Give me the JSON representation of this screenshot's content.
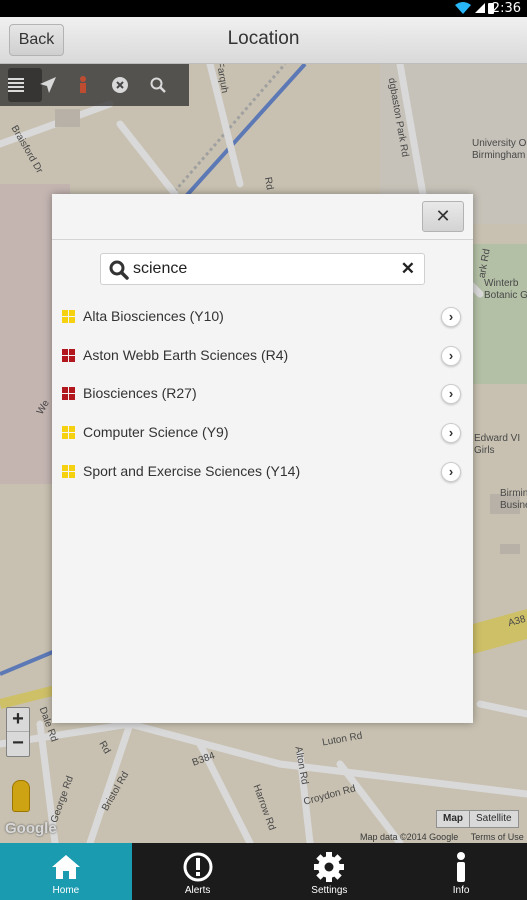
{
  "status_bar": {
    "time": "2:36"
  },
  "header": {
    "back_label": "Back",
    "title": "Location"
  },
  "map": {
    "street_labels": [
      "Farquh",
      "dgbaston Park Rd",
      "University O",
      "Birmingham",
      "Bristol Rd",
      "B384",
      "Luton Rd",
      "Croydon Rd",
      "Harrow Rd",
      "Alton Rd",
      "George Rd",
      "Dale Rd",
      "Edward VI",
      "Girls",
      "Winterb",
      "Botanic G",
      "Birmin",
      "Busine",
      "A38",
      "Braisford Dr",
      "Rd",
      "Rd",
      "ark Rd",
      "We"
    ],
    "zoom_in": "+",
    "zoom_out": "−",
    "logo_text": "Google",
    "map_types": [
      "Map",
      "Satellite"
    ],
    "attribution": "Map data ©2014 Google",
    "terms": "Terms of Use"
  },
  "dialog": {
    "close_symbol": "✕",
    "search": {
      "value": "science",
      "clear_symbol": "✕"
    },
    "results": [
      {
        "label": "Alta Biosciences (Y10)",
        "color": "#f5d10f"
      },
      {
        "label": "Aston Webb Earth Sciences (R4)",
        "color": "#b3171e"
      },
      {
        "label": "Biosciences (R27)",
        "color": "#b3171e"
      },
      {
        "label": "Computer Science (Y9)",
        "color": "#f5d10f"
      },
      {
        "label": "Sport and Exercise Sciences (Y14)",
        "color": "#f5d10f"
      }
    ]
  },
  "nav": [
    {
      "label": "Home",
      "icon": "home-icon",
      "active": true
    },
    {
      "label": "Alerts",
      "icon": "alert-icon",
      "active": false
    },
    {
      "label": "Settings",
      "icon": "gear-icon",
      "active": false
    },
    {
      "label": "Info",
      "icon": "info-icon",
      "active": false
    }
  ],
  "colors": {
    "accent": "#1a9bb0",
    "nav_bg": "#1b1b1b",
    "header_bg": "#e4e4e4"
  }
}
